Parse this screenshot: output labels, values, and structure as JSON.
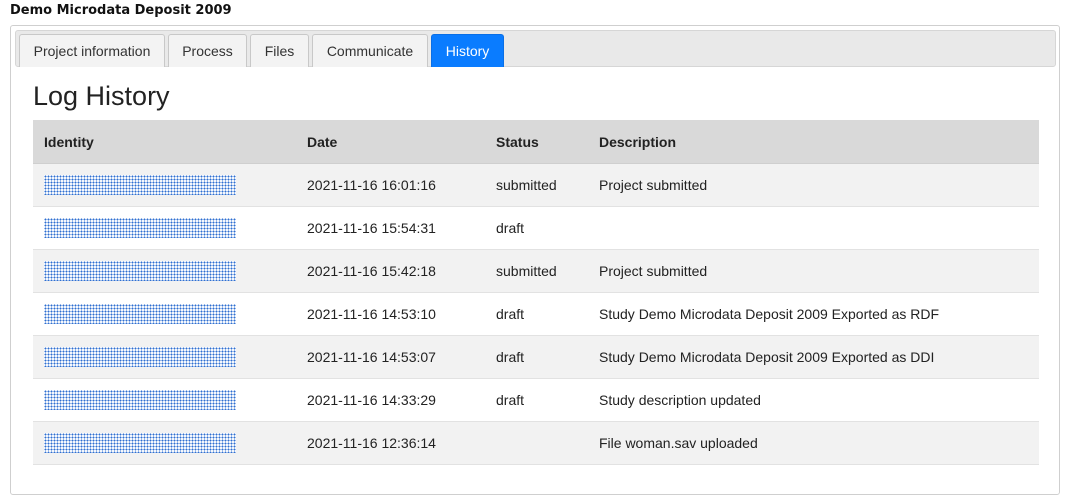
{
  "page": {
    "title": "Demo Microdata Deposit 2009"
  },
  "tabs": [
    {
      "label": "Project information",
      "active": false
    },
    {
      "label": "Process",
      "active": false
    },
    {
      "label": "Files",
      "active": false
    },
    {
      "label": "Communicate",
      "active": false
    },
    {
      "label": "History",
      "active": true
    }
  ],
  "history": {
    "heading": "Log History",
    "columns": [
      "Identity",
      "Date",
      "Status",
      "Description"
    ],
    "rows": [
      {
        "identity": "",
        "date": "2021-11-16 16:01:16",
        "status": "submitted",
        "description": "Project submitted"
      },
      {
        "identity": "",
        "date": "2021-11-16 15:54:31",
        "status": "draft",
        "description": ""
      },
      {
        "identity": "",
        "date": "2021-11-16 15:42:18",
        "status": "submitted",
        "description": "Project submitted"
      },
      {
        "identity": "",
        "date": "2021-11-16 14:53:10",
        "status": "draft",
        "description": "Study Demo Microdata Deposit 2009 Exported as RDF"
      },
      {
        "identity": "",
        "date": "2021-11-16 14:53:07",
        "status": "draft",
        "description": "Study Demo Microdata Deposit 2009 Exported as DDI"
      },
      {
        "identity": "",
        "date": "2021-11-16 14:33:29",
        "status": "draft",
        "description": "Study description updated"
      },
      {
        "identity": "",
        "date": "2021-11-16 12:36:14",
        "status": "",
        "description": "File woman.sav uploaded"
      }
    ]
  },
  "colors": {
    "active_tab": "#0a7cff",
    "header_bg": "#d9d9d9",
    "redaction": "#2f6fd0"
  }
}
